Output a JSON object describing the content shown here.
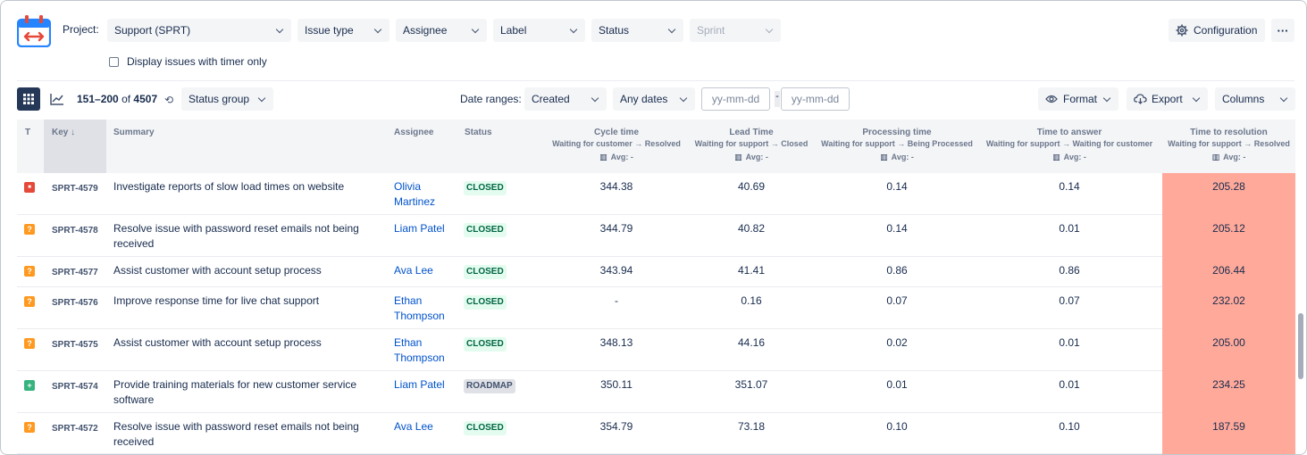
{
  "filters": {
    "project_label": "Project:",
    "project_value": "Support (SPRT)",
    "issue_type": "Issue type",
    "assignee": "Assignee",
    "label": "Label",
    "status": "Status",
    "sprint": "Sprint",
    "timer_only_label": "Display issues with timer only",
    "configuration": "Configuration",
    "more": "···"
  },
  "toolbar": {
    "range_start": "151–200",
    "range_of": "of",
    "total": "4507",
    "status_group": "Status group",
    "date_ranges_label": "Date ranges:",
    "date_field": "Created",
    "date_preset": "Any dates",
    "date_from_placeholder": "yy-mm-dd",
    "date_sep": "-",
    "date_to_placeholder": "yy-mm-dd",
    "format": "Format",
    "export": "Export",
    "columns": "Columns"
  },
  "table": {
    "headers": {
      "type": "T",
      "key": "Key ↓",
      "summary": "Summary",
      "assignee": "Assignee",
      "status": "Status"
    },
    "metrics": [
      {
        "title": "Cycle time",
        "sub": "Waiting for customer → Resolved",
        "avg": "Avg: -"
      },
      {
        "title": "Lead Time",
        "sub": "Waiting for support → Closed",
        "avg": "Avg: -"
      },
      {
        "title": "Processing time",
        "sub": "Waiting for support → Being Processed",
        "avg": "Avg: -"
      },
      {
        "title": "Time to answer",
        "sub": "Waiting for support → Waiting for customer",
        "avg": "Avg: -"
      },
      {
        "title": "Time to resolution",
        "sub": "Waiting for support → Resolved",
        "avg": "Avg: -"
      }
    ],
    "rows": [
      {
        "type": "bug",
        "key": "SPRT-4579",
        "summary": "Investigate reports of slow load times on website",
        "assignee": "Olivia Martinez",
        "status": "CLOSED",
        "cycle": "344.38",
        "lead": "40.69",
        "processing": "0.14",
        "answer": "0.14",
        "resolution": "205.28"
      },
      {
        "type": "question",
        "key": "SPRT-4578",
        "summary": "Resolve issue with password reset emails not being received",
        "assignee": "Liam Patel",
        "status": "CLOSED",
        "cycle": "344.79",
        "lead": "40.82",
        "processing": "0.14",
        "answer": "0.01",
        "resolution": "205.12"
      },
      {
        "type": "question",
        "key": "SPRT-4577",
        "summary": "Assist customer with account setup process",
        "assignee": "Ava Lee",
        "status": "CLOSED",
        "cycle": "343.94",
        "lead": "41.41",
        "processing": "0.86",
        "answer": "0.86",
        "resolution": "206.44"
      },
      {
        "type": "question",
        "key": "SPRT-4576",
        "summary": "Improve response time for live chat support",
        "assignee": "Ethan Thompson",
        "status": "CLOSED",
        "cycle": "-",
        "lead": "0.16",
        "processing": "0.07",
        "answer": "0.07",
        "resolution": "232.02"
      },
      {
        "type": "question",
        "key": "SPRT-4575",
        "summary": "Assist customer with account setup process",
        "assignee": "Ethan Thompson",
        "status": "CLOSED",
        "cycle": "348.13",
        "lead": "44.16",
        "processing": "0.02",
        "answer": "0.01",
        "resolution": "205.00"
      },
      {
        "type": "improvement",
        "key": "SPRT-4574",
        "summary": "Provide training materials for new customer service software",
        "assignee": "Liam Patel",
        "status": "ROADMAP",
        "cycle": "350.11",
        "lead": "351.07",
        "processing": "0.01",
        "answer": "0.01",
        "resolution": "234.25"
      },
      {
        "type": "question",
        "key": "SPRT-4572",
        "summary": "Resolve issue with password reset emails not being received",
        "assignee": "Ava Lee",
        "status": "CLOSED",
        "cycle": "354.79",
        "lead": "73.18",
        "processing": "0.10",
        "answer": "0.10",
        "resolution": "187.59"
      }
    ]
  },
  "colors": {
    "bug": "#e5493a",
    "question": "#ff991f",
    "improvement": "#36b37e",
    "resolution_highlight": "#ffa99a",
    "link": "#0052cc"
  }
}
